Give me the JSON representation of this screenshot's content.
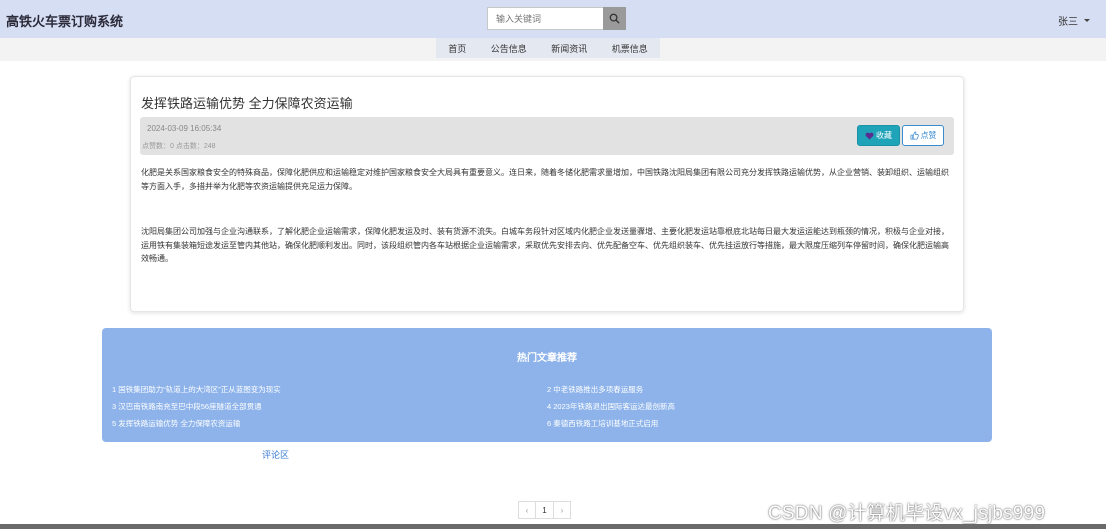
{
  "header": {
    "brand": "高铁火车票订购系统",
    "search_placeholder": "输入关键词",
    "user": "张三"
  },
  "nav": {
    "items": [
      "首页",
      "公告信息",
      "新闻资讯",
      "机票信息"
    ]
  },
  "article": {
    "title": "发挥铁路运输优势 全力保障农资运输",
    "date": "2024-03-09 16:05:34",
    "counts": "点赞数：0   点击数：248",
    "collect_label": "收藏",
    "like_label": "点赞",
    "paragraphs": [
      "化肥是关系国家粮食安全的特殊商品，保障化肥供应和运输稳定对维护国家粮食安全大局具有重要意义。连日来，随着冬储化肥需求量增加，中国铁路沈阳局集团有限公司充分发挥铁路运输优势，从企业营销、装卸组织、运输组织等方面入手，多措并举为化肥等农资运输提供充足运力保障。",
      "沈阳局集团公司加强与企业沟通联系，了解化肥企业运输需求，保障化肥发运及时、装有货源不流失。白城车务段针对区域内化肥企业发送量骤增、主要化肥发运站靠根底北站每日最大发运运能达到瓶颈的情况，积极与企业对接，运用铁有集装箱短途发运至管内其他站，确保化肥顺利发出。同时，该段组织管内各车站根据企业运输需求，采取优先安排去向、优先配备空车、优先组织装车、优先挂运放行等措施，最大限度压缩列车停留时间，确保化肥运输高效畅通。"
    ]
  },
  "hot": {
    "title": "热门文章推荐",
    "left": [
      "1 国铁集团助力“轨道上的大湾区”正从蓝图变为现实",
      "3 汉巴南铁路南充至巴中段56座隧道全部贯通",
      "5 发挥铁路运输优势 全力保障农资运输"
    ],
    "right": [
      "2 中老铁路推出多项春运服务",
      "4 2023年铁路退出国际客运达最创新高",
      "6 秦德西铁路工培训基地正式启用"
    ]
  },
  "comment_label": "评论区",
  "pagination": {
    "prev": "‹",
    "current": "1",
    "next": "›"
  },
  "watermark": "CSDN @计算机毕设vx_jsjbs999",
  "colors": {
    "topbar": "#d6def3",
    "hot_bg": "#8db3ea",
    "collect_btn": "#1fa3b8",
    "like_btn": "#3a8bd0"
  }
}
